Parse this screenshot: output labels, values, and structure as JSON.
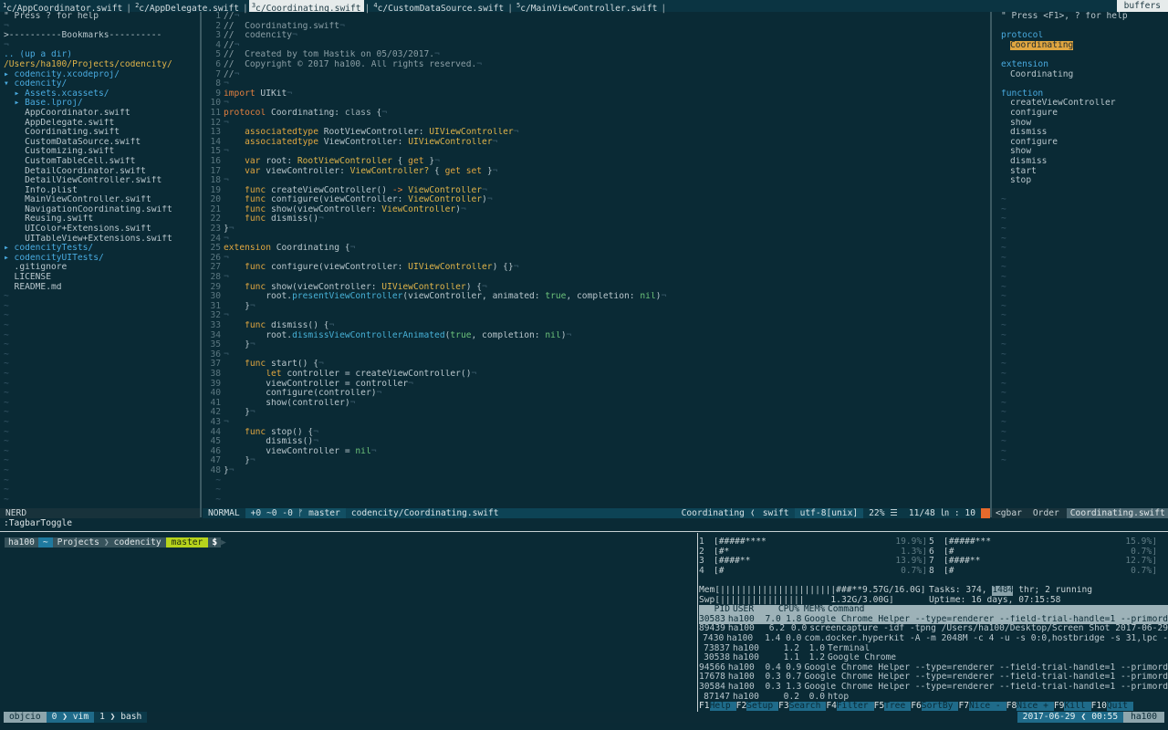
{
  "tabs": [
    {
      "num": "1",
      "label": "c/AppCoordinator.swift",
      "active": false
    },
    {
      "num": "2",
      "label": "c/AppDelegate.swift",
      "active": false
    },
    {
      "num": "3",
      "label": "c/Coordinating.swift",
      "active": true
    },
    {
      "num": "4",
      "label": "c/CustomDataSource.swift",
      "active": false
    },
    {
      "num": "5",
      "label": "c/MainViewController.swift",
      "active": false
    }
  ],
  "buffers_label": "buffers",
  "tree": {
    "help": "\" Press ? for help",
    "bookmarks": ">----------Bookmarks----------",
    "up": ".. (up a dir)",
    "path": "/Users/ha100/Projects/codencity/",
    "items": [
      {
        "text": "▸ codencity.xcodeproj/",
        "kind": "dir"
      },
      {
        "text": "▾ codencity/",
        "kind": "dir"
      },
      {
        "text": "  ▸ Assets.xcassets/",
        "kind": "dir"
      },
      {
        "text": "  ▸ Base.lproj/",
        "kind": "dir"
      },
      {
        "text": "    AppCoordinator.swift",
        "kind": "file"
      },
      {
        "text": "    AppDelegate.swift",
        "kind": "file"
      },
      {
        "text": "    Coordinating.swift",
        "kind": "file"
      },
      {
        "text": "    CustomDataSource.swift",
        "kind": "file"
      },
      {
        "text": "    Customizing.swift",
        "kind": "file"
      },
      {
        "text": "    CustomTableCell.swift",
        "kind": "file"
      },
      {
        "text": "    DetailCoordinator.swift",
        "kind": "file"
      },
      {
        "text": "    DetailViewController.swift",
        "kind": "file"
      },
      {
        "text": "    Info.plist",
        "kind": "file"
      },
      {
        "text": "    MainViewController.swift",
        "kind": "file"
      },
      {
        "text": "    NavigationCoordinating.swift",
        "kind": "file"
      },
      {
        "text": "    Reusing.swift",
        "kind": "file"
      },
      {
        "text": "    UIColor+Extensions.swift",
        "kind": "file"
      },
      {
        "text": "    UITableView+Extensions.swift",
        "kind": "file"
      },
      {
        "text": "▸ codencityTests/",
        "kind": "dir"
      },
      {
        "text": "▸ codencityUITests/",
        "kind": "dir"
      },
      {
        "text": "  .gitignore",
        "kind": "file"
      },
      {
        "text": "  LICENSE",
        "kind": "file"
      },
      {
        "text": "  README.md",
        "kind": "file"
      }
    ]
  },
  "code": [
    [
      [
        "//",
        "com"
      ]
    ],
    [
      [
        "//  Coordinating.swift",
        "com"
      ]
    ],
    [
      [
        "//  codencity",
        "com"
      ]
    ],
    [
      [
        "//",
        "com"
      ]
    ],
    [
      [
        "//  Created by tom Hastik on 05/03/2017.",
        "com"
      ]
    ],
    [
      [
        "//  Copyright © 2017 ha100. All rights reserved.",
        "com"
      ]
    ],
    [
      [
        "//",
        "com"
      ]
    ],
    [],
    [
      [
        "import",
        "kw"
      ],
      [
        " UIKit",
        ""
      ]
    ],
    [],
    [
      [
        "protocol",
        "kw"
      ],
      [
        " Coordinating: ",
        ""
      ],
      [
        "class",
        "kw2"
      ],
      [
        " {",
        ""
      ]
    ],
    [],
    [
      [
        "    ",
        ""
      ],
      [
        "associatedtype",
        "kw3"
      ],
      [
        " RootViewController: ",
        ""
      ],
      [
        "UIViewController",
        "type"
      ]
    ],
    [
      [
        "    ",
        ""
      ],
      [
        "associatedtype",
        "kw3"
      ],
      [
        " ViewController: ",
        ""
      ],
      [
        "UIViewController",
        "type"
      ]
    ],
    [],
    [
      [
        "    ",
        ""
      ],
      [
        "var",
        "kw3"
      ],
      [
        " root: ",
        ""
      ],
      [
        "RootViewController",
        "type"
      ],
      [
        " { ",
        ""
      ],
      [
        "get",
        "kw3"
      ],
      [
        " }",
        ""
      ]
    ],
    [
      [
        "    ",
        ""
      ],
      [
        "var",
        "kw3"
      ],
      [
        " viewController: ",
        ""
      ],
      [
        "ViewController?",
        "type"
      ],
      [
        " { ",
        ""
      ],
      [
        "get set",
        "kw3"
      ],
      [
        " }",
        ""
      ]
    ],
    [],
    [
      [
        "    ",
        ""
      ],
      [
        "func",
        "kw3"
      ],
      [
        " createViewController() ",
        ""
      ],
      [
        "->",
        "kw"
      ],
      [
        " ",
        ""
      ],
      [
        "ViewController",
        "type"
      ]
    ],
    [
      [
        "    ",
        ""
      ],
      [
        "func",
        "kw3"
      ],
      [
        " configure(viewController: ",
        ""
      ],
      [
        "ViewController",
        "type"
      ],
      [
        ")",
        ""
      ]
    ],
    [
      [
        "    ",
        ""
      ],
      [
        "func",
        "kw3"
      ],
      [
        " show(viewController: ",
        ""
      ],
      [
        "ViewController",
        "type"
      ],
      [
        ")",
        ""
      ]
    ],
    [
      [
        "    ",
        ""
      ],
      [
        "func",
        "kw3"
      ],
      [
        " dismiss()",
        ""
      ]
    ],
    [
      [
        "}",
        ""
      ]
    ],
    [],
    [
      [
        "extension",
        "kw3"
      ],
      [
        " Coordinating {",
        ""
      ]
    ],
    [],
    [
      [
        "    ",
        ""
      ],
      [
        "func",
        "kw3"
      ],
      [
        " configure(viewController: ",
        ""
      ],
      [
        "UIViewController",
        "type"
      ],
      [
        ") {}",
        ""
      ]
    ],
    [],
    [
      [
        "    ",
        ""
      ],
      [
        "func",
        "kw3"
      ],
      [
        " show(viewController: ",
        ""
      ],
      [
        "UIViewController",
        "type"
      ],
      [
        ") {",
        ""
      ]
    ],
    [
      [
        "        root.",
        ""
      ],
      [
        "presentViewController",
        "fn"
      ],
      [
        "(viewController, animated: ",
        ""
      ],
      [
        "true",
        "lit"
      ],
      [
        ", completion: ",
        ""
      ],
      [
        "nil",
        "lit"
      ],
      [
        ")",
        ""
      ]
    ],
    [
      [
        "    }",
        ""
      ]
    ],
    [],
    [
      [
        "    ",
        ""
      ],
      [
        "func",
        "kw3"
      ],
      [
        " dismiss() {",
        ""
      ]
    ],
    [
      [
        "        root.",
        ""
      ],
      [
        "dismissViewControllerAnimated",
        "fn"
      ],
      [
        "(",
        ""
      ],
      [
        "true",
        "lit"
      ],
      [
        ", completion: ",
        ""
      ],
      [
        "nil",
        "lit"
      ],
      [
        ")",
        ""
      ]
    ],
    [
      [
        "    }",
        ""
      ]
    ],
    [],
    [
      [
        "    ",
        ""
      ],
      [
        "func",
        "kw3"
      ],
      [
        " start() {",
        ""
      ]
    ],
    [
      [
        "        ",
        ""
      ],
      [
        "let",
        "kw3"
      ],
      [
        " controller = createViewController()",
        ""
      ]
    ],
    [
      [
        "        viewController = controller",
        ""
      ]
    ],
    [
      [
        "        configure(controller)",
        ""
      ]
    ],
    [
      [
        "        show(controller)",
        ""
      ]
    ],
    [
      [
        "    }",
        ""
      ]
    ],
    [],
    [
      [
        "    ",
        ""
      ],
      [
        "func",
        "kw3"
      ],
      [
        " stop() {",
        ""
      ]
    ],
    [
      [
        "        dismiss()",
        ""
      ]
    ],
    [
      [
        "        viewController = ",
        ""
      ],
      [
        "nil",
        "lit"
      ]
    ],
    [
      [
        "    }",
        ""
      ]
    ],
    [
      [
        "}",
        ""
      ]
    ]
  ],
  "tagbar": {
    "help": "\" Press <F1>, ? for help",
    "sections": [
      {
        "title": "protocol",
        "items": [
          "Coordinating"
        ],
        "highlight": 0
      },
      {
        "title": "extension",
        "items": [
          "Coordinating"
        ],
        "highlight": -1
      },
      {
        "title": "function",
        "items": [
          "createViewController",
          "configure",
          "show",
          "dismiss",
          "configure",
          "show",
          "dismiss",
          "start",
          "stop"
        ],
        "highlight": -1
      }
    ]
  },
  "status": {
    "nerd": "NERD",
    "mode": "NORMAL",
    "git": "+0 ~0 -0 ᚠ master",
    "file": "codencity/Coordinating.swift",
    "tag": "Coordinating",
    "filetype": "swift",
    "encoding": "utf-8[unix]",
    "percent": "22% ☰",
    "position": "11/48 ㏑ : 10",
    "tagbar_left": "<gbar",
    "tagbar_order": "Order",
    "tagbar_current": "Coordinating.swift"
  },
  "cmdline": ":TagbarToggle",
  "prompt": {
    "user": "ha100",
    "home": "~",
    "dir1": "Projects",
    "dir2": "codencity",
    "branch": "master",
    "symbol": "$"
  },
  "htop": {
    "cpus": [
      {
        "num": "1",
        "bar": "[#####****",
        "pct": "19.9%]"
      },
      {
        "num": "2",
        "bar": "[#*",
        "pct": "1.3%]"
      },
      {
        "num": "3",
        "bar": "[####**",
        "pct": "13.9%]"
      },
      {
        "num": "4",
        "bar": "[#",
        "pct": "0.7%]"
      },
      {
        "num": "5",
        "bar": "[#####***",
        "pct": "15.9%]"
      },
      {
        "num": "6",
        "bar": "[#",
        "pct": "0.7%]"
      },
      {
        "num": "7",
        "bar": "[####**",
        "pct": "12.7%]"
      },
      {
        "num": "8",
        "bar": "[#",
        "pct": "0.7%]"
      }
    ],
    "mem_label": "Mem[||||||||||||||||||||||###**9.57G/16.0G]",
    "swp_label": "Swp[||||||||||||||||     1.32G/3.00G]",
    "tasks": "Tasks: 374, ",
    "threads": "1484",
    "tasks_rest": " thr; 2 running",
    "uptime": "Uptime: 16 days, 07:15:58",
    "header": [
      "PID",
      "USER",
      "CPU%",
      "MEM%",
      "Command"
    ],
    "procs": [
      [
        "30583",
        "ha100",
        "7.0",
        "1.8",
        "Google Chrome Helper --type=renderer --field-trial-handle=1 --primord"
      ],
      [
        "89439",
        "ha100",
        "6.2",
        "0.0",
        "screencapture -idf -tpng /Users/ha100/Desktop/Screen Shot 2017-06-29"
      ],
      [
        "7430",
        "ha100",
        "1.4",
        "0.0",
        "com.docker.hyperkit -A -m 2048M -c 4 -u -s 0:0,hostbridge -s 31,lpc -"
      ],
      [
        "73837",
        "ha100",
        "1.2",
        "1.0",
        "Terminal"
      ],
      [
        "30538",
        "ha100",
        "1.1",
        "1.2",
        "Google Chrome"
      ],
      [
        "94566",
        "ha100",
        "0.4",
        "0.9",
        "Google Chrome Helper --type=renderer --field-trial-handle=1 --primord"
      ],
      [
        "17678",
        "ha100",
        "0.3",
        "0.7",
        "Google Chrome Helper --type=renderer --field-trial-handle=1 --primord"
      ],
      [
        "30584",
        "ha100",
        "0.3",
        "1.3",
        "Google Chrome Helper --type=renderer --field-trial-handle=1 --primord"
      ],
      [
        "87147",
        "ha100",
        "0.2",
        "0.0",
        "htop"
      ]
    ],
    "fkeys": [
      {
        "k": "F1",
        "l": "Help"
      },
      {
        "k": "F2",
        "l": "Setup"
      },
      {
        "k": "F3",
        "l": "Search"
      },
      {
        "k": "F4",
        "l": "Filter"
      },
      {
        "k": "F5",
        "l": "Tree"
      },
      {
        "k": "F6",
        "l": "SortBy"
      },
      {
        "k": "F7",
        "l": "Nice -"
      },
      {
        "k": "F8",
        "l": "Nice +"
      },
      {
        "k": "F9",
        "l": "Kill"
      },
      {
        "k": "F10",
        "l": "Quit"
      }
    ]
  },
  "tmux": {
    "session": "objcio",
    "win0": "0",
    "win0_name": "vim",
    "win1": "1",
    "win1_name": "bash",
    "date": "2017-06-29",
    "time": "00:55",
    "host": "ha100"
  },
  "colors": {
    "bg": "#0a2a35",
    "tabline": "#0b3442",
    "status": "#0d4355",
    "comment": "#8a9ea5",
    "keyword": "#e27f3f",
    "type": "#e0b44a",
    "function": "#47b0d6",
    "literal": "#6cc27a",
    "prompt_branch": "#b7d31c"
  }
}
